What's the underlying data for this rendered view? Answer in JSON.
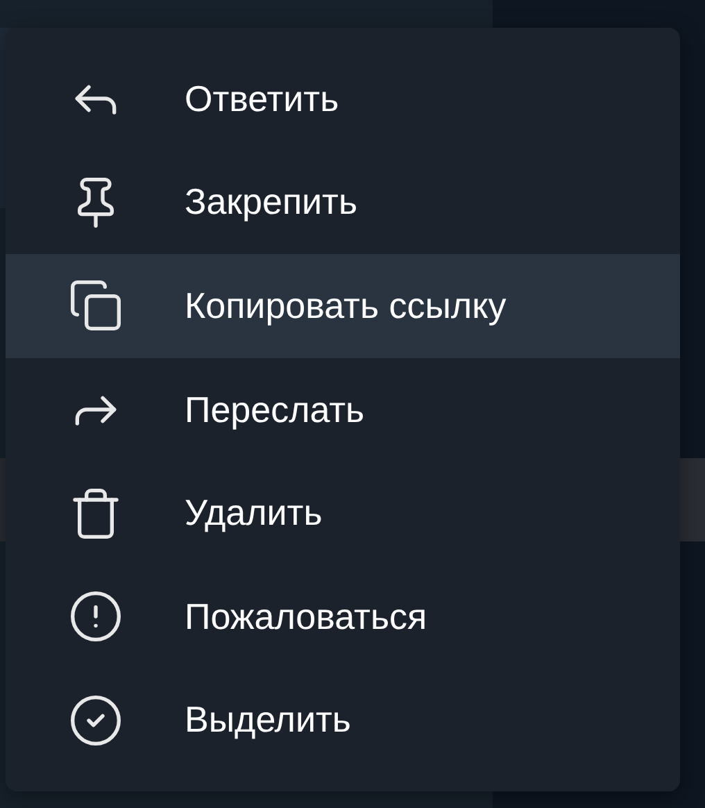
{
  "context_menu": {
    "items": [
      {
        "label": "Ответить",
        "selected": false
      },
      {
        "label": "Закрепить",
        "selected": false
      },
      {
        "label": "Копировать ссылку",
        "selected": true
      },
      {
        "label": "Переслать",
        "selected": false
      },
      {
        "label": "Удалить",
        "selected": false
      },
      {
        "label": "Пожаловаться",
        "selected": false
      },
      {
        "label": "Выделить",
        "selected": false
      }
    ]
  }
}
